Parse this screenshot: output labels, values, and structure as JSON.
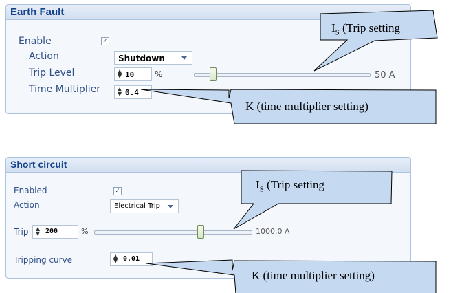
{
  "earth_fault": {
    "title": "Earth Fault",
    "enable_label": "Enable",
    "enable_checked": true,
    "action_label": "Action",
    "action_value": "Shutdown",
    "trip_level_label": "Trip Level",
    "trip_level_value": "10",
    "trip_level_unit": "%",
    "slider_value": "50 A",
    "time_multiplier_label": "Time Multiplier",
    "time_multiplier_value": "0.4"
  },
  "short_circuit": {
    "title": "Short circuit",
    "enabled_label": "Enabled",
    "enabled_checked": true,
    "action_label": "Action",
    "action_value": "Electrical Trip",
    "trip_label": "Trip",
    "trip_value": "200",
    "trip_unit": "%",
    "slider_value": "1000.0 A",
    "tripping_curve_label": "Tripping curve",
    "tripping_curve_value": "0.01"
  },
  "callouts": {
    "is_prefix": "I",
    "is_sub": "S",
    "is_rest": " (Trip setting",
    "k_text": "K (time multiplier setting)"
  },
  "colors": {
    "callout_fill": "#c5d9f1",
    "panel_title": "#15428b",
    "label": "#2f4f88"
  }
}
